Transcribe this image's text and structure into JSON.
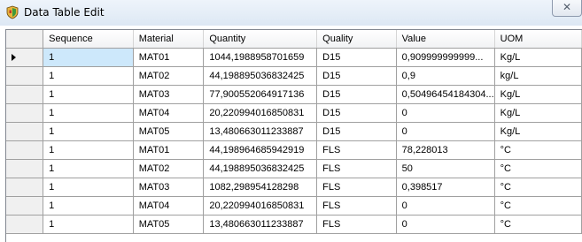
{
  "window": {
    "title": "Data Table Edit",
    "app_icon": "green-shield-icon",
    "close_icon": "close-icon"
  },
  "grid": {
    "columns": [
      "Sequence",
      "Material",
      "Quantity",
      "Quality",
      "Value",
      "UOM"
    ],
    "current_row_indicator": "row-pointer-icon",
    "rows": [
      [
        "1",
        "MAT01",
        "1044,1988958701659",
        "D15",
        "0,909999999999...",
        "Kg/L"
      ],
      [
        "1",
        "MAT02",
        "44,198895036832425",
        "D15",
        "0,9",
        "kg/L"
      ],
      [
        "1",
        "MAT03",
        "77,900552064917136",
        "D15",
        "0,50496454184304...",
        "Kg/L"
      ],
      [
        "1",
        "MAT04",
        "20,220994016850831",
        "D15",
        "0",
        "Kg/L"
      ],
      [
        "1",
        "MAT05",
        "13,480663011233887",
        "D15",
        "0",
        "Kg/L"
      ],
      [
        "1",
        "MAT01",
        "44,198964685942919",
        "FLS",
        "78,228013",
        "°C"
      ],
      [
        "1",
        "MAT02",
        "44,198895036832425",
        "FLS",
        "50",
        "°C"
      ],
      [
        "1",
        "MAT03",
        "1082,298954128298",
        "FLS",
        "0,398517",
        "°C"
      ],
      [
        "1",
        "MAT04",
        "20,220994016850831",
        "FLS",
        "0",
        "°C"
      ],
      [
        "1",
        "MAT05",
        "13,480663011233887",
        "FLS",
        "0",
        "°C"
      ]
    ]
  }
}
